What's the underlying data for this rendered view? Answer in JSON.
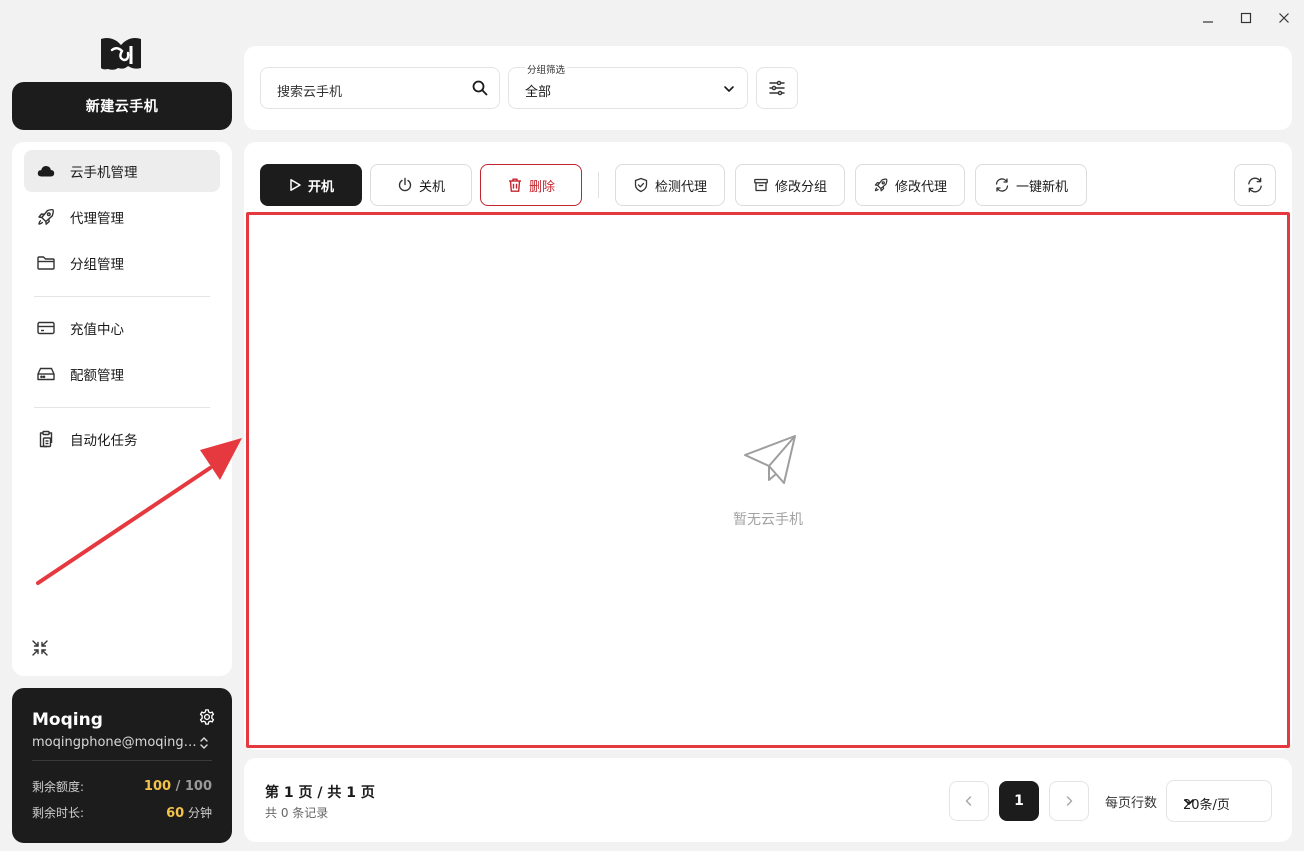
{
  "window": {
    "controls": [
      "minimize-icon",
      "maximize-icon",
      "close-icon"
    ]
  },
  "sidebar": {
    "logo": "moqing-logo",
    "new_button_label": "新建云手机",
    "items": [
      {
        "label": "云手机管理",
        "icon": "cloud-icon",
        "active": true
      },
      {
        "label": "代理管理",
        "icon": "rocket-icon"
      },
      {
        "label": "分组管理",
        "icon": "folder-icon"
      },
      {
        "label": "充值中心",
        "icon": "credit-card-icon"
      },
      {
        "label": "配额管理",
        "icon": "hard-drive-icon"
      },
      {
        "label": "自动化任务",
        "icon": "clipboard-icon"
      }
    ],
    "collapse_icon": "collapse-icon"
  },
  "user": {
    "name": "Moqing",
    "email": "moqingphone@moqing.com",
    "stats": [
      {
        "label": "剩余额度:",
        "value": "100",
        "sep": " / ",
        "total": "100"
      },
      {
        "label": "剩余时长:",
        "value": "60",
        "unit": " 分钟"
      }
    ]
  },
  "filters": {
    "search_placeholder": "搜索云手机",
    "group_label": "分组筛选",
    "group_value": "全部"
  },
  "toolbar": {
    "start": "开机",
    "stop": "关机",
    "delete": "删除",
    "check_proxy": "检测代理",
    "edit_group": "修改分组",
    "edit_proxy": "修改代理",
    "one_click_new": "一键新机"
  },
  "empty_state": {
    "icon": "paper-plane-icon",
    "text": "暂无云手机"
  },
  "pagination": {
    "page_info": "第 1 页 / 共 1 页",
    "total": "共 0 条记录",
    "current_page": "1",
    "per_page_label": "每页行数",
    "per_page_value": "20条/页"
  },
  "colors": {
    "dark": "#1c1c1c",
    "danger": "#c4242e",
    "highlight": "#f2c24a",
    "annotation": "#e5393f"
  }
}
